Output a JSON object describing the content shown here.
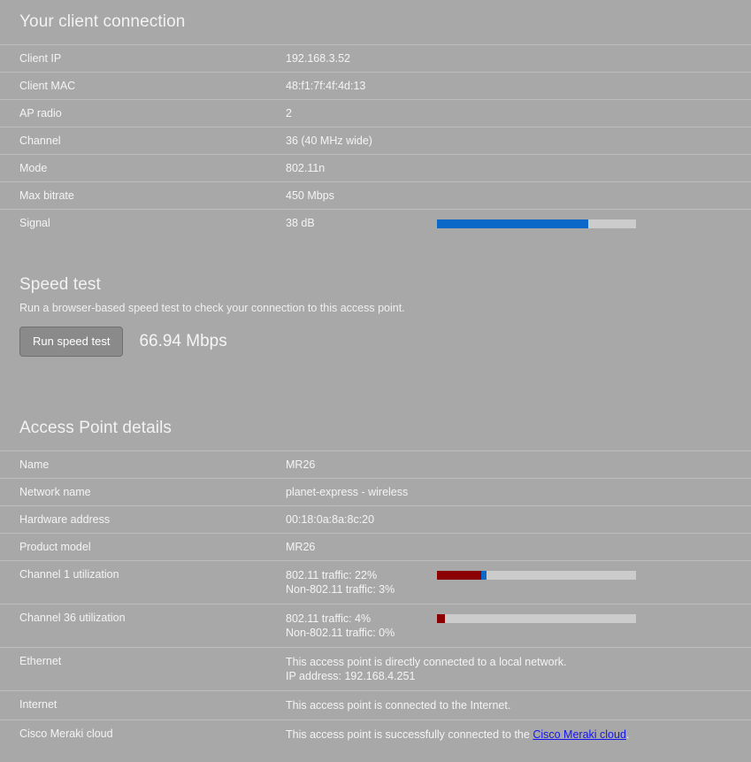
{
  "client_connection": {
    "title": "Your client connection",
    "rows": [
      {
        "label": "Client IP",
        "value": "192.168.3.52"
      },
      {
        "label": "Client MAC",
        "value": "48:f1:7f:4f:4d:13"
      },
      {
        "label": "AP radio",
        "value": "2"
      },
      {
        "label": "Channel",
        "value": "36 (40 MHz wide)"
      },
      {
        "label": "Mode",
        "value": "802.11n"
      },
      {
        "label": "Max bitrate",
        "value": "450 Mbps"
      },
      {
        "label": "Signal",
        "value": "38 dB"
      }
    ],
    "signal_bar": {
      "filled_percent": 76,
      "fill_color": "#0a69c8",
      "track_color": "#cccccc"
    }
  },
  "speed_test": {
    "title": "Speed test",
    "description": "Run a browser-based speed test to check your connection to this access point.",
    "button_label": "Run speed test",
    "result": "66.94 Mbps"
  },
  "access_point": {
    "title": "Access Point details",
    "rows": [
      {
        "label": "Name",
        "value": "MR26"
      },
      {
        "label": "Network name",
        "value": "planet-express - wireless"
      },
      {
        "label": "Hardware address",
        "value": "00:18:0a:8a:8c:20"
      },
      {
        "label": "Product model",
        "value": "MR26"
      }
    ],
    "channel1": {
      "label": "Channel 1 utilization",
      "line1": "802.11 traffic: 22%",
      "line2": "Non-802.11 traffic: 3%",
      "wifi_percent": 22,
      "nonwifi_percent": 3
    },
    "channel36": {
      "label": "Channel 36 utilization",
      "line1": "802.11 traffic: 4%",
      "line2": "Non-802.11 traffic: 0%",
      "wifi_percent": 4,
      "nonwifi_percent": 0
    },
    "ethernet": {
      "label": "Ethernet",
      "line1": "This access point is directly connected to a local network.",
      "line2": "IP address: 192.168.4.251"
    },
    "internet": {
      "label": "Internet",
      "line1": "This access point is connected to the Internet."
    },
    "meraki_cloud": {
      "label": "Cisco Meraki cloud",
      "text_before": "This access point is successfully connected to the ",
      "link_text": "Cisco Meraki cloud",
      "text_after": "."
    }
  },
  "colors": {
    "background": "#a8a8a8",
    "row_border": "#bdbdbd",
    "bar_track": "#cccccc",
    "bar_blue": "#0a69c8",
    "bar_red": "#8b0000",
    "link": "#1414ee"
  }
}
